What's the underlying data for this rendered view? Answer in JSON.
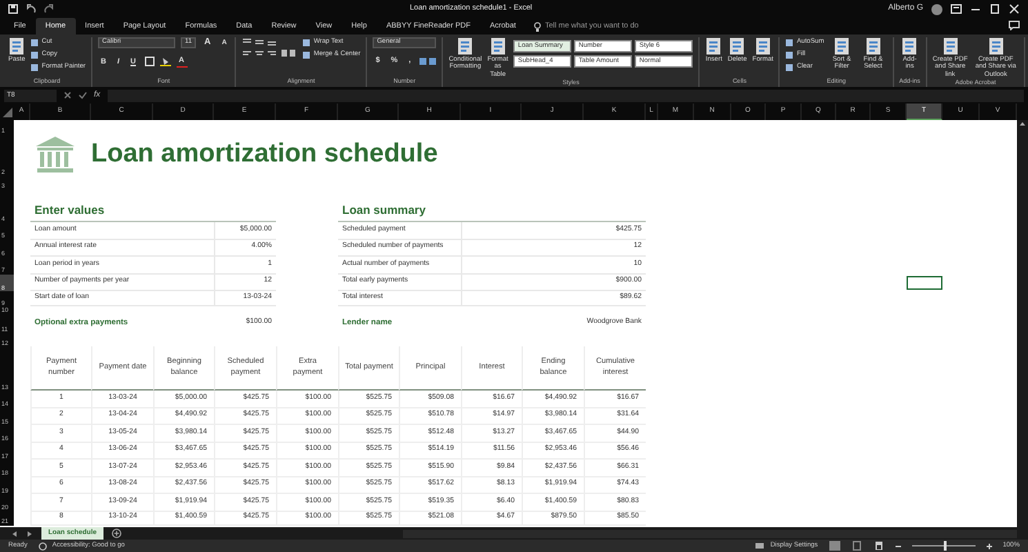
{
  "window": {
    "title": "Loan amortization schedule1  -  Excel",
    "user": "Alberto G"
  },
  "ribbon_tabs": [
    {
      "label": "File",
      "selected": false
    },
    {
      "label": "Home",
      "selected": true
    },
    {
      "label": "Insert",
      "selected": false
    },
    {
      "label": "Page Layout",
      "selected": false
    },
    {
      "label": "Formulas",
      "selected": false
    },
    {
      "label": "Data",
      "selected": false
    },
    {
      "label": "Review",
      "selected": false
    },
    {
      "label": "View",
      "selected": false
    },
    {
      "label": "Help",
      "selected": false
    },
    {
      "label": "ABBYY FineReader PDF",
      "selected": false
    },
    {
      "label": "Acrobat",
      "selected": false
    }
  ],
  "tell_me": {
    "placeholder": "Tell me what you want to do"
  },
  "ribbon_groups": [
    {
      "label": "Clipboard",
      "controls": [
        {
          "kind": "large",
          "label": "Paste"
        },
        {
          "kind": "stack",
          "items": [
            "Cut",
            "Copy",
            "Format Painter"
          ]
        }
      ]
    },
    {
      "label": "Font",
      "controls": [
        {
          "kind": "font",
          "name": "Calibri",
          "size": "11",
          "sizers": [
            "A",
            "A"
          ],
          "glyphs": [
            "B",
            "I",
            "U"
          ],
          "font_color": "A"
        }
      ]
    },
    {
      "label": "Alignment",
      "controls": [
        {
          "kind": "align",
          "items": [
            "Wrap Text",
            "Merge & Center"
          ]
        }
      ]
    },
    {
      "label": "Number",
      "controls": [
        {
          "kind": "number",
          "format": "General",
          "glyphs": [
            "$",
            "%",
            ","
          ]
        }
      ]
    },
    {
      "label": "Styles",
      "controls": [
        {
          "kind": "large",
          "label": "Conditional Formatting"
        },
        {
          "kind": "large",
          "label": "Format as Table"
        },
        {
          "kind": "gallery",
          "items": [
            "Loan Summary",
            "Number",
            "Style 6",
            "SubHead_4",
            "Table Amount",
            "Normal"
          ]
        }
      ]
    },
    {
      "label": "Cells",
      "controls": [
        {
          "kind": "large",
          "label": "Insert"
        },
        {
          "kind": "large",
          "label": "Delete"
        },
        {
          "kind": "large",
          "label": "Format"
        }
      ]
    },
    {
      "label": "Editing",
      "controls": [
        {
          "kind": "stack",
          "items": [
            "AutoSum",
            "Fill",
            "Clear"
          ]
        },
        {
          "kind": "large",
          "label": "Sort & Filter"
        },
        {
          "kind": "large",
          "label": "Find & Select"
        }
      ]
    },
    {
      "label": "Add-ins",
      "controls": [
        {
          "kind": "large",
          "label": "Add-ins"
        }
      ]
    },
    {
      "label": "Adobe Acrobat",
      "controls": [
        {
          "kind": "large",
          "label": "Create PDF and Share link"
        },
        {
          "kind": "large",
          "label": "Create PDF and Share via Outlook"
        }
      ]
    }
  ],
  "formula_bar": {
    "name_box": "T8",
    "function_label": "fx"
  },
  "column_headers": [
    {
      "label": "A",
      "selected": false
    },
    {
      "label": "B",
      "selected": false
    },
    {
      "label": "C",
      "selected": false
    },
    {
      "label": "D",
      "selected": false
    },
    {
      "label": "E",
      "selected": false
    },
    {
      "label": "F",
      "selected": false
    },
    {
      "label": "G",
      "selected": false
    },
    {
      "label": "H",
      "selected": false
    },
    {
      "label": "I",
      "selected": false
    },
    {
      "label": "J",
      "selected": false
    },
    {
      "label": "K",
      "selected": false
    },
    {
      "label": "L",
      "selected": false
    },
    {
      "label": "M",
      "selected": false
    },
    {
      "label": "N",
      "selected": false
    },
    {
      "label": "O",
      "selected": false
    },
    {
      "label": "P",
      "selected": false
    },
    {
      "label": "Q",
      "selected": false
    },
    {
      "label": "R",
      "selected": false
    },
    {
      "label": "S",
      "selected": false
    },
    {
      "label": "T",
      "selected": true
    },
    {
      "label": "U",
      "selected": false
    },
    {
      "label": "V",
      "selected": false
    }
  ],
  "row_headers": [
    {
      "label": "1",
      "selected": false
    },
    {
      "label": "2",
      "selected": false
    },
    {
      "label": "3",
      "selected": false
    },
    {
      "label": "4",
      "selected": false
    },
    {
      "label": "5",
      "selected": false
    },
    {
      "label": "6",
      "selected": false
    },
    {
      "label": "7",
      "selected": false
    },
    {
      "label": "8",
      "selected": true
    },
    {
      "label": "9",
      "selected": false
    },
    {
      "label": "10",
      "selected": false
    },
    {
      "label": "11",
      "selected": false
    },
    {
      "label": "12",
      "selected": false
    },
    {
      "label": "13",
      "selected": false
    },
    {
      "label": "14",
      "selected": false
    },
    {
      "label": "15",
      "selected": false
    },
    {
      "label": "16",
      "selected": false
    },
    {
      "label": "17",
      "selected": false
    },
    {
      "label": "18",
      "selected": false
    },
    {
      "label": "19",
      "selected": false
    },
    {
      "label": "20",
      "selected": false
    },
    {
      "label": "21",
      "selected": false
    }
  ],
  "title": "Loan amortization schedule",
  "enter_values": {
    "title": "Enter values",
    "rows": [
      {
        "label": "Loan amount",
        "value": "$5,000.00"
      },
      {
        "label": "Annual interest rate",
        "value": "4.00%"
      },
      {
        "label": "Loan period in years",
        "value": "1"
      },
      {
        "label": "Number of payments per year",
        "value": "12"
      },
      {
        "label": "Start date of loan",
        "value": "13-03-24"
      }
    ],
    "extra": {
      "label": "Optional extra payments",
      "value": "$100.00"
    }
  },
  "loan_summary": {
    "title": "Loan summary",
    "rows": [
      {
        "label": "Scheduled payment",
        "value": "$425.75"
      },
      {
        "label": "Scheduled number of payments",
        "value": "12"
      },
      {
        "label": "Actual number of payments",
        "value": "10"
      },
      {
        "label": "Total early payments",
        "value": "$900.00"
      },
      {
        "label": "Total interest",
        "value": "$89.62"
      }
    ],
    "lender": {
      "label": "Lender name",
      "value": "Woodgrove Bank"
    }
  },
  "schedule": {
    "columns": [
      "Payment number",
      "Payment date",
      "Beginning balance",
      "Scheduled payment",
      "Extra payment",
      "Total payment",
      "Principal",
      "Interest",
      "Ending balance",
      "Cumulative interest"
    ],
    "rows": [
      [
        "1",
        "13-03-24",
        "$5,000.00",
        "$425.75",
        "$100.00",
        "$525.75",
        "$509.08",
        "$16.67",
        "$4,490.92",
        "$16.67"
      ],
      [
        "2",
        "13-04-24",
        "$4,490.92",
        "$425.75",
        "$100.00",
        "$525.75",
        "$510.78",
        "$14.97",
        "$3,980.14",
        "$31.64"
      ],
      [
        "3",
        "13-05-24",
        "$3,980.14",
        "$425.75",
        "$100.00",
        "$525.75",
        "$512.48",
        "$13.27",
        "$3,467.65",
        "$44.90"
      ],
      [
        "4",
        "13-06-24",
        "$3,467.65",
        "$425.75",
        "$100.00",
        "$525.75",
        "$514.19",
        "$11.56",
        "$2,953.46",
        "$56.46"
      ],
      [
        "5",
        "13-07-24",
        "$2,953.46",
        "$425.75",
        "$100.00",
        "$525.75",
        "$515.90",
        "$9.84",
        "$2,437.56",
        "$66.31"
      ],
      [
        "6",
        "13-08-24",
        "$2,437.56",
        "$425.75",
        "$100.00",
        "$525.75",
        "$517.62",
        "$8.13",
        "$1,919.94",
        "$74.43"
      ],
      [
        "7",
        "13-09-24",
        "$1,919.94",
        "$425.75",
        "$100.00",
        "$525.75",
        "$519.35",
        "$6.40",
        "$1,400.59",
        "$80.83"
      ],
      [
        "8",
        "13-10-24",
        "$1,400.59",
        "$425.75",
        "$100.00",
        "$525.75",
        "$521.08",
        "$4.67",
        "$879.50",
        "$85.50"
      ]
    ]
  },
  "sheet_tabs": [
    {
      "label": "Loan schedule",
      "selected": true
    }
  ],
  "status_bar": {
    "ready": "Ready",
    "accessibility": "Accessibility: Good to go",
    "display_settings": "Display Settings",
    "zoom": "100%"
  },
  "zoom_slider": {
    "level": 0.5
  }
}
